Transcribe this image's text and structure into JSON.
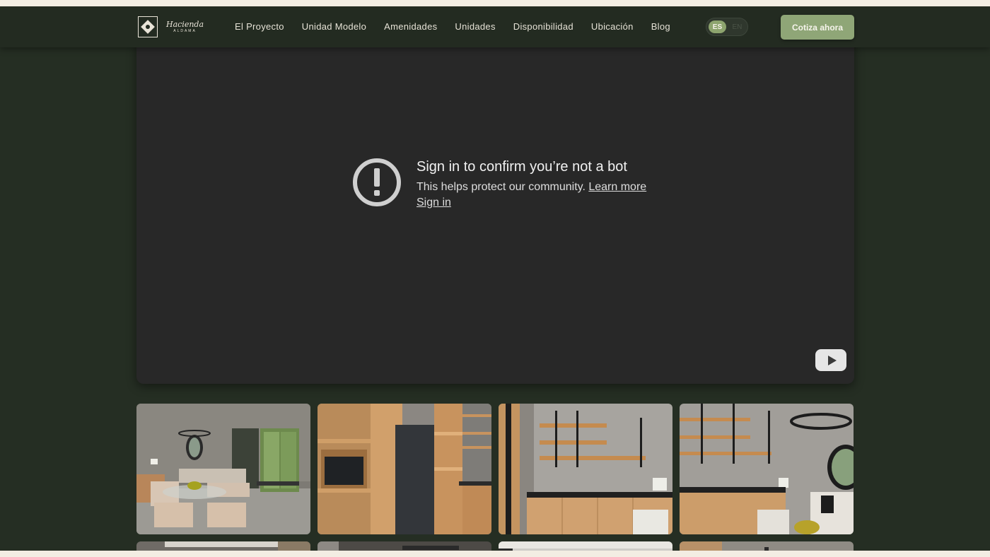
{
  "header": {
    "logo_script": "Hacienda",
    "logo_sub": "ALDAMA",
    "nav": [
      {
        "label": "El Proyecto"
      },
      {
        "label": "Unidad Modelo"
      },
      {
        "label": "Amenidades"
      },
      {
        "label": "Unidades"
      },
      {
        "label": "Disponibilidad"
      },
      {
        "label": "Ubicación"
      },
      {
        "label": "Blog"
      }
    ],
    "lang_active": "ES",
    "lang_inactive": "EN",
    "cta_label": "Cotiza ahora"
  },
  "video": {
    "title": "Sign in to confirm you’re not a bot",
    "body": "This helps protect our community.",
    "learn_more": "Learn more",
    "sign_in": "Sign in"
  },
  "colors": {
    "background": "#252e23",
    "navbar": "#232b21",
    "accent": "#8fa677",
    "video_bg": "#282828"
  },
  "gallery": {
    "photos": [
      "living-dining-room",
      "wood-shelving-fridge",
      "kitchen-shelves",
      "kitchen-living"
    ]
  }
}
